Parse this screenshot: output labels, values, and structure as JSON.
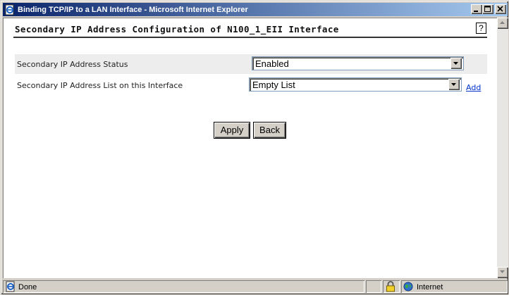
{
  "window": {
    "title": "Binding TCP/IP to a LAN Interface - Microsoft Internet Explorer"
  },
  "page": {
    "title": "Secondary IP Address Configuration of N100_1_EII Interface",
    "help_label": "?"
  },
  "form": {
    "status": {
      "label": "Secondary IP Address Status",
      "selected": "Enabled"
    },
    "ip_list": {
      "label": "Secondary IP Address List on this Interface",
      "selected": "Empty List",
      "add_label": "Add"
    }
  },
  "buttons": {
    "apply": "Apply",
    "back": "Back"
  },
  "statusbar": {
    "text": "Done",
    "zone": "Internet"
  },
  "colors": {
    "titlebar_start": "#0a246a",
    "titlebar_end": "#a6caf0",
    "link": "#0033cc"
  }
}
